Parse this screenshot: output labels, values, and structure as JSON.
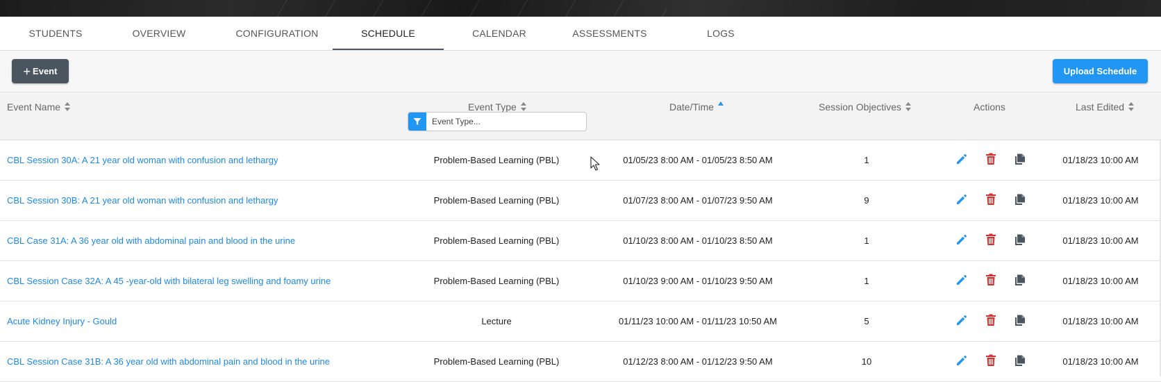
{
  "tabs": [
    {
      "label": "STUDENTS"
    },
    {
      "label": "OVERVIEW"
    },
    {
      "label": "CONFIGURATION"
    },
    {
      "label": "SCHEDULE",
      "active": true
    },
    {
      "label": "CALENDAR"
    },
    {
      "label": "ASSESSMENTS"
    },
    {
      "label": "LOGS"
    }
  ],
  "toolbar": {
    "add_event_label": "Event",
    "upload_label": "Upload Schedule"
  },
  "columns": {
    "event_name": "Event Name",
    "event_type": "Event Type",
    "date_time": "Date/Time",
    "session_objectives": "Session Objectives",
    "actions": "Actions",
    "last_edited": "Last Edited"
  },
  "filter": {
    "placeholder": "Event Type..."
  },
  "rows": [
    {
      "name": "CBL Session 30A: A 21 year old woman with confusion and lethargy",
      "type": "Problem-Based Learning (PBL)",
      "datetime": "01/05/23 8:00 AM - 01/05/23 8:50 AM",
      "objectives": "1",
      "edited": "01/18/23 10:00 AM"
    },
    {
      "name": "CBL Session 30B: A 21 year old woman with confusion and lethargy",
      "type": "Problem-Based Learning (PBL)",
      "datetime": "01/07/23 8:00 AM - 01/07/23 9:50 AM",
      "objectives": "9",
      "edited": "01/18/23 10:00 AM"
    },
    {
      "name": "CBL Case 31A: A 36 year old with abdominal pain and blood in the urine",
      "type": "Problem-Based Learning (PBL)",
      "datetime": "01/10/23 8:00 AM - 01/10/23 8:50 AM",
      "objectives": "1",
      "edited": "01/18/23 10:00 AM"
    },
    {
      "name": "CBL Session Case 32A: A 45 -year-old with bilateral leg swelling and foamy urine",
      "type": "Problem-Based Learning (PBL)",
      "datetime": "01/10/23 9:00 AM - 01/10/23 9:50 AM",
      "objectives": "1",
      "edited": "01/18/23 10:00 AM"
    },
    {
      "name": "Acute Kidney Injury - Gould",
      "type": "Lecture",
      "datetime": "01/11/23 10:00 AM - 01/11/23 10:50 AM",
      "objectives": "5",
      "edited": "01/18/23 10:00 AM"
    },
    {
      "name": "CBL Session Case 31B: A 36 year old with abdominal pain and blood in the urine",
      "type": "Problem-Based Learning (PBL)",
      "datetime": "01/12/23 8:00 AM - 01/12/23 9:50 AM",
      "objectives": "10",
      "edited": "01/18/23 10:00 AM"
    }
  ],
  "colors": {
    "accent": "#2196f3",
    "link": "#1e88e5",
    "dark_button": "#4a5560",
    "delete": "#d32f2f",
    "copy": "#4a5560"
  },
  "icons": {
    "add": "plus-icon",
    "filter": "filter-icon",
    "edit": "pencil-icon",
    "delete": "trash-icon",
    "copy": "copy-icon"
  }
}
